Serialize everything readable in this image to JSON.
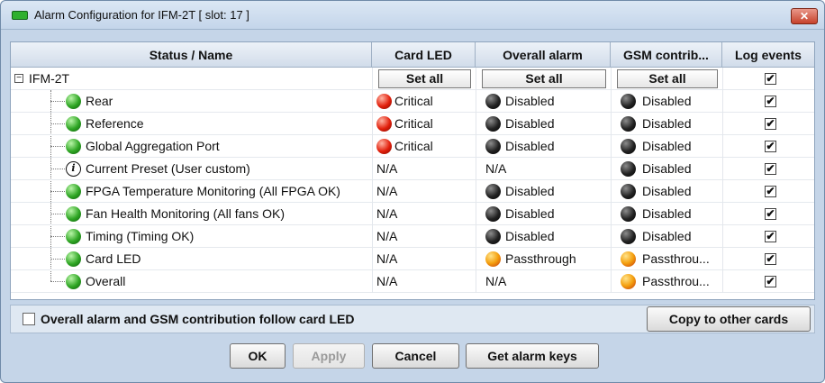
{
  "window": {
    "title": "Alarm Configuration for IFM-2T [ slot: 17 ]",
    "close_label": "✕"
  },
  "table": {
    "headers": [
      "Status / Name",
      "Card LED",
      "Overall alarm",
      "GSM contrib...",
      "Log events"
    ],
    "root": {
      "name": "IFM-2T",
      "expander": "−",
      "setall_label": "Set all",
      "log": "✔"
    },
    "rows": [
      {
        "name": "Rear",
        "status": "green",
        "card_led": "Critical",
        "card_led_icon": "red",
        "overall": "Disabled",
        "overall_icon": "black",
        "gsm": "Disabled",
        "gsm_icon": "black",
        "log": "✔"
      },
      {
        "name": "Reference",
        "status": "green",
        "card_led": "Critical",
        "card_led_icon": "red",
        "overall": "Disabled",
        "overall_icon": "black",
        "gsm": "Disabled",
        "gsm_icon": "black",
        "log": "✔"
      },
      {
        "name": "Global Aggregation Port",
        "status": "green",
        "card_led": "Critical",
        "card_led_icon": "red",
        "overall": "Disabled",
        "overall_icon": "black",
        "gsm": "Disabled",
        "gsm_icon": "black",
        "log": "✔"
      },
      {
        "name": "Current Preset (User custom)",
        "status": "info",
        "card_led": "N/A",
        "card_led_icon": "",
        "overall": "N/A",
        "overall_icon": "",
        "gsm": "Disabled",
        "gsm_icon": "black",
        "log": "✔"
      },
      {
        "name": "FPGA Temperature Monitoring (All FPGA OK)",
        "status": "green",
        "card_led": "N/A",
        "card_led_icon": "",
        "overall": "Disabled",
        "overall_icon": "black",
        "gsm": "Disabled",
        "gsm_icon": "black",
        "log": "✔"
      },
      {
        "name": "Fan Health Monitoring (All fans OK)",
        "status": "green",
        "card_led": "N/A",
        "card_led_icon": "",
        "overall": "Disabled",
        "overall_icon": "black",
        "gsm": "Disabled",
        "gsm_icon": "black",
        "log": "✔"
      },
      {
        "name": "Timing (Timing OK)",
        "status": "green",
        "card_led": "N/A",
        "card_led_icon": "",
        "overall": "Disabled",
        "overall_icon": "black",
        "gsm": "Disabled",
        "gsm_icon": "black",
        "log": "✔"
      },
      {
        "name": "Card LED",
        "status": "green",
        "card_led": "N/A",
        "card_led_icon": "",
        "overall": "Passthrough",
        "overall_icon": "orange",
        "gsm": "Passthrou...",
        "gsm_icon": "orange",
        "log": "✔"
      },
      {
        "name": "Overall",
        "status": "green",
        "card_led": "N/A",
        "card_led_icon": "",
        "overall": "N/A",
        "overall_icon": "",
        "gsm": "Passthrou...",
        "gsm_icon": "orange",
        "log": "✔"
      }
    ],
    "info_glyph": "i"
  },
  "footer": {
    "follow_label": "Overall alarm and GSM contribution follow card LED",
    "follow_checked": false,
    "copy_label": "Copy to other cards"
  },
  "buttons": {
    "ok": "OK",
    "apply": "Apply",
    "cancel": "Cancel",
    "get_keys": "Get alarm keys"
  },
  "colors": {
    "titlebar": "#c4d5ea",
    "green_led": "#2fa624",
    "red_led": "#e21f0b",
    "orange_led": "#f4a00f",
    "black_led": "#222222"
  }
}
